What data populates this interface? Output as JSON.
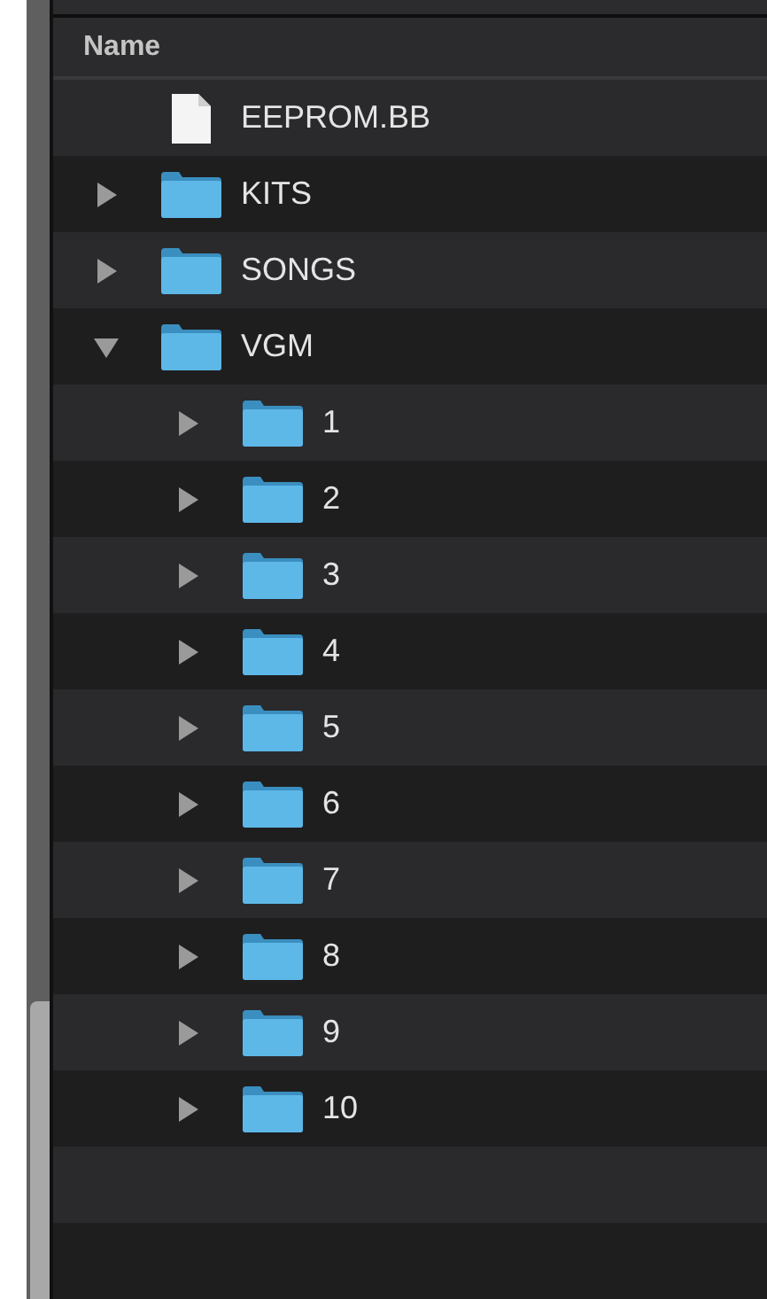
{
  "column_header": "Name",
  "tree": [
    {
      "name": "EEPROM.BB",
      "kind": "file"
    },
    {
      "name": "KITS",
      "kind": "folder",
      "expanded": false
    },
    {
      "name": "SONGS",
      "kind": "folder",
      "expanded": false
    },
    {
      "name": "VGM",
      "kind": "folder",
      "expanded": true,
      "children": [
        {
          "name": "1",
          "kind": "folder",
          "expanded": false
        },
        {
          "name": "2",
          "kind": "folder",
          "expanded": false
        },
        {
          "name": "3",
          "kind": "folder",
          "expanded": false
        },
        {
          "name": "4",
          "kind": "folder",
          "expanded": false
        },
        {
          "name": "5",
          "kind": "folder",
          "expanded": false
        },
        {
          "name": "6",
          "kind": "folder",
          "expanded": false
        },
        {
          "name": "7",
          "kind": "folder",
          "expanded": false
        },
        {
          "name": "8",
          "kind": "folder",
          "expanded": false
        },
        {
          "name": "9",
          "kind": "folder",
          "expanded": false
        },
        {
          "name": "10",
          "kind": "folder",
          "expanded": false
        }
      ]
    }
  ]
}
